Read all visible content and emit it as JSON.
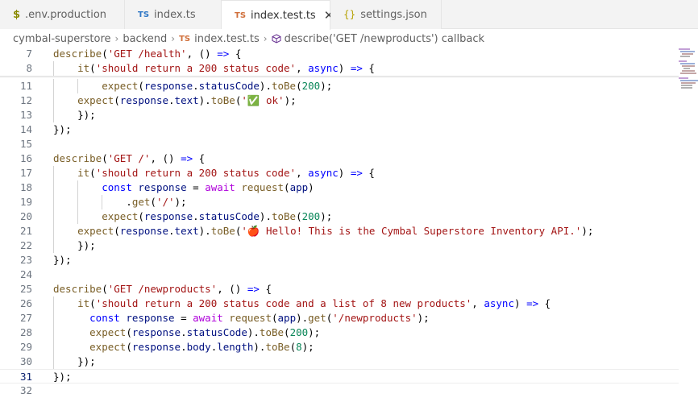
{
  "tabs": [
    {
      "icon": "$",
      "label": ".env.production"
    },
    {
      "icon": "TS",
      "label": "index.ts"
    },
    {
      "icon": "TS",
      "label": "index.test.ts",
      "close": "✕"
    },
    {
      "icon": "{}",
      "label": "settings.json"
    }
  ],
  "breadcrumb": {
    "root": "cymbal-superstore",
    "folder": "backend",
    "file_icon": "TS",
    "file": "index.test.ts",
    "symbol": "describe('GET /newproducts') callback"
  },
  "editor": {
    "active_line": "31",
    "lines": [
      {
        "num": "7",
        "text": "describe('GET /health', () => {"
      },
      {
        "num": "8",
        "text": "    it('should return a 200 status code', async () => {"
      },
      {
        "num": "11",
        "text": "        expect(response.statusCode).toBe(200);"
      },
      {
        "num": "12",
        "text": "    expect(response.text).toBe('✅ ok');"
      },
      {
        "num": "13",
        "text": "    });"
      },
      {
        "num": "14",
        "text": "});"
      },
      {
        "num": "15",
        "text": ""
      },
      {
        "num": "16",
        "text": "describe('GET /', () => {"
      },
      {
        "num": "17",
        "text": "    it('should return a 200 status code', async () => {"
      },
      {
        "num": "18",
        "text": "        const response = await request(app)"
      },
      {
        "num": "19",
        "text": "            .get('/');"
      },
      {
        "num": "20",
        "text": "        expect(response.statusCode).toBe(200);"
      },
      {
        "num": "21",
        "text": "    expect(response.text).toBe('🍎 Hello! This is the Cymbal Superstore Inventory API.');"
      },
      {
        "num": "22",
        "text": "    });"
      },
      {
        "num": "23",
        "text": "});"
      },
      {
        "num": "24",
        "text": ""
      },
      {
        "num": "25",
        "text": "describe('GET /newproducts', () => {"
      },
      {
        "num": "26",
        "text": "    it('should return a 200 status code and a list of 8 new products', async () => {"
      },
      {
        "num": "27",
        "text": "      const response = await request(app).get('/newproducts');"
      },
      {
        "num": "28",
        "text": "      expect(response.statusCode).toBe(200);"
      },
      {
        "num": "29",
        "text": "      expect(response.body.length).toBe(8);"
      },
      {
        "num": "30",
        "text": "    });"
      },
      {
        "num": "31",
        "text": "});"
      },
      {
        "num": "32",
        "text": ""
      }
    ]
  },
  "colors": {
    "keyword": "#0000ff",
    "control": "#af00db",
    "string": "#a31515",
    "variable": "#001080",
    "function": "#795e26",
    "number": "#098658"
  }
}
